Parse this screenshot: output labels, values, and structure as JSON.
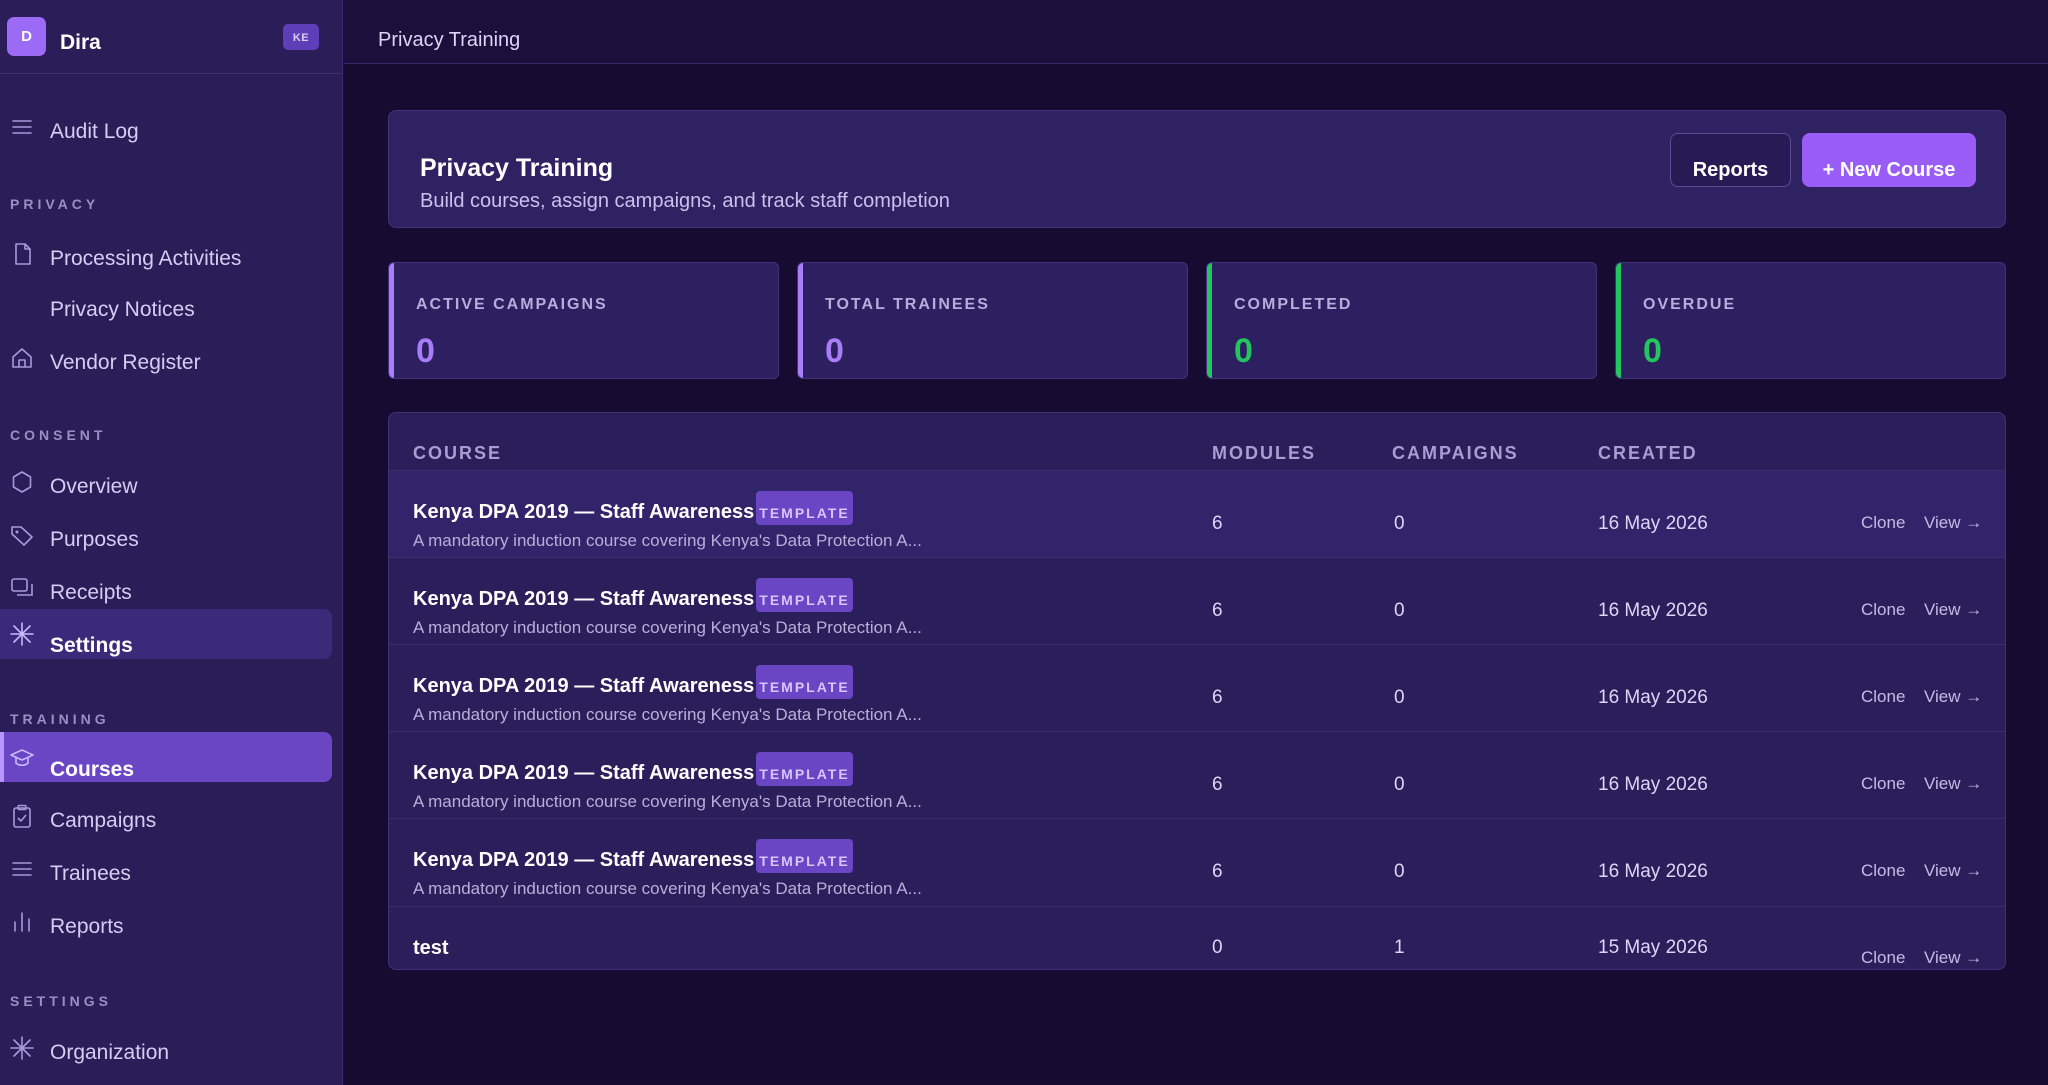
{
  "sidebar": {
    "brand": {
      "logo": "D",
      "name": "Dira",
      "badge": "KE"
    },
    "top_items": [
      {
        "label": "Audit Log",
        "icon": "menu-icon"
      }
    ],
    "sections": [
      {
        "title": "PRIVACY",
        "items": [
          {
            "label": "Processing Activities",
            "icon": "file-icon"
          },
          {
            "label": "Privacy Notices",
            "icon": ""
          },
          {
            "label": "Vendor Register",
            "icon": "home-icon"
          }
        ]
      },
      {
        "title": "CONSENT",
        "items": [
          {
            "label": "Overview",
            "icon": "hexagon-icon"
          },
          {
            "label": "Purposes",
            "icon": "tag-icon"
          },
          {
            "label": "Receipts",
            "icon": "copy-icon"
          },
          {
            "label": "Settings",
            "icon": "asterisk-icon"
          }
        ]
      },
      {
        "title": "TRAINING",
        "items": [
          {
            "label": "Courses",
            "icon": "graduation-cap-icon"
          },
          {
            "label": "Campaigns",
            "icon": "clipboard-check-icon"
          },
          {
            "label": "Trainees",
            "icon": "list-icon"
          },
          {
            "label": "Reports",
            "icon": "bar-chart-icon"
          }
        ]
      },
      {
        "title": "SETTINGS",
        "items": [
          {
            "label": "Organization",
            "icon": "asterisk-icon"
          }
        ]
      }
    ]
  },
  "topbar": {
    "title": "Privacy Training"
  },
  "header": {
    "title": "Privacy Training",
    "subtitle": "Build courses, assign campaigns, and track staff completion",
    "reports_label": "Reports",
    "new_course_label": "+ New Course"
  },
  "stats": [
    {
      "label": "ACTIVE CAMPAIGNS",
      "value": "0",
      "color": "#a97cf8"
    },
    {
      "label": "TOTAL TRAINEES",
      "value": "0",
      "color": "#a97cf8"
    },
    {
      "label": "COMPLETED",
      "value": "0",
      "color": "#22c55e"
    },
    {
      "label": "OVERDUE",
      "value": "0",
      "color": "#22c55e"
    }
  ],
  "table": {
    "columns": [
      "COURSE",
      "MODULES",
      "CAMPAIGNS",
      "CREATED"
    ],
    "rows": [
      {
        "name": "Kenya DPA 2019 — Staff Awareness",
        "tag": "TEMPLATE",
        "description": "A mandatory induction course covering Kenya's Data Protection A...",
        "modules": "6",
        "campaigns": "0",
        "created": "16 May 2026",
        "clone": "Clone",
        "view": "View →"
      },
      {
        "name": "Kenya DPA 2019 — Staff Awareness",
        "tag": "TEMPLATE",
        "description": "A mandatory induction course covering Kenya's Data Protection A...",
        "modules": "6",
        "campaigns": "0",
        "created": "16 May 2026",
        "clone": "Clone",
        "view": "View →"
      },
      {
        "name": "Kenya DPA 2019 — Staff Awareness",
        "tag": "TEMPLATE",
        "description": "A mandatory induction course covering Kenya's Data Protection A...",
        "modules": "6",
        "campaigns": "0",
        "created": "16 May 2026",
        "clone": "Clone",
        "view": "View →"
      },
      {
        "name": "Kenya DPA 2019 — Staff Awareness",
        "tag": "TEMPLATE",
        "description": "A mandatory induction course covering Kenya's Data Protection A...",
        "modules": "6",
        "campaigns": "0",
        "created": "16 May 2026",
        "clone": "Clone",
        "view": "View →"
      },
      {
        "name": "Kenya DPA 2019 — Staff Awareness",
        "tag": "TEMPLATE",
        "description": "A mandatory induction course covering Kenya's Data Protection A...",
        "modules": "6",
        "campaigns": "0",
        "created": "16 May 2026",
        "clone": "Clone",
        "view": "View →"
      },
      {
        "name": "test",
        "tag": "",
        "description": "",
        "modules": "0",
        "campaigns": "1",
        "created": "15 May 2026",
        "clone": "Clone",
        "view": "View →"
      }
    ]
  }
}
